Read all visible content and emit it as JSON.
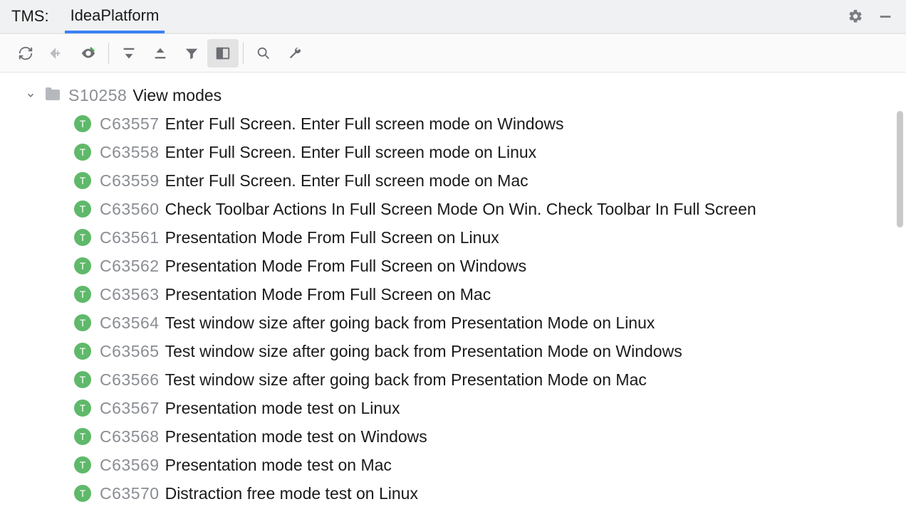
{
  "header": {
    "title": "TMS:",
    "tab": "IdeaPlatform"
  },
  "suite": {
    "id": "S10258",
    "title": "View modes"
  },
  "badge_letter": "T",
  "cases": [
    {
      "id": "C63557",
      "title": "Enter Full Screen. Enter Full screen mode on Windows"
    },
    {
      "id": "C63558",
      "title": "Enter Full Screen. Enter Full screen mode on Linux"
    },
    {
      "id": "C63559",
      "title": "Enter Full Screen. Enter Full screen mode on Mac"
    },
    {
      "id": "C63560",
      "title": "Check Toolbar Actions In Full Screen Mode On Win. Check Toolbar In Full Screen"
    },
    {
      "id": "C63561",
      "title": "Presentation Mode From Full Screen on Linux"
    },
    {
      "id": "C63562",
      "title": "Presentation Mode From Full Screen on Windows"
    },
    {
      "id": "C63563",
      "title": "Presentation Mode From Full Screen on Mac"
    },
    {
      "id": "C63564",
      "title": "Test window size after going back from Presentation Mode on Linux"
    },
    {
      "id": "C63565",
      "title": "Test window size after going back from Presentation Mode on Windows"
    },
    {
      "id": "C63566",
      "title": "Test window size after going back from Presentation Mode on Mac"
    },
    {
      "id": "C63567",
      "title": "Presentation mode test on Linux"
    },
    {
      "id": "C63568",
      "title": "Presentation mode test on Windows"
    },
    {
      "id": "C63569",
      "title": "Presentation mode test on Mac"
    },
    {
      "id": "C63570",
      "title": "Distraction free mode test on Linux"
    }
  ]
}
